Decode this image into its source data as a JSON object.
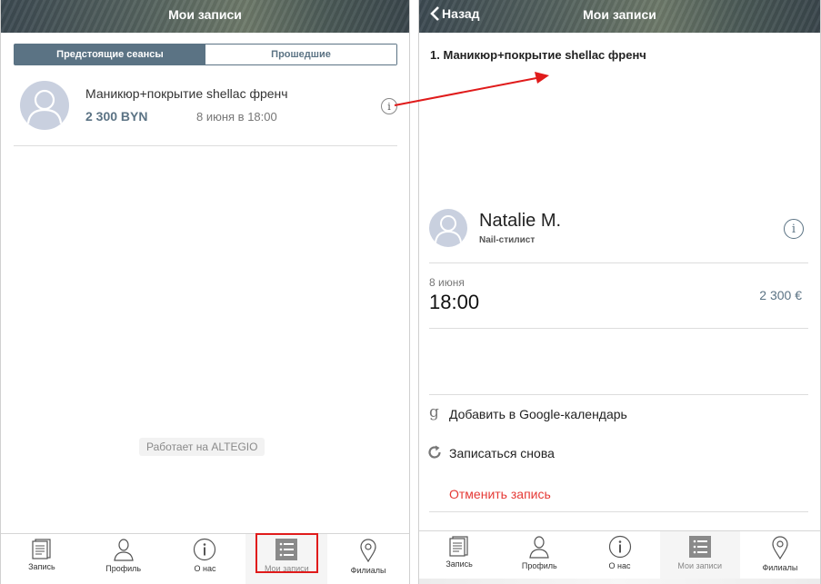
{
  "left_screen": {
    "header": {
      "title": "Мои записи"
    },
    "tabs": [
      {
        "label": "Предстоящие сеансы",
        "active": true
      },
      {
        "label": "Прошедшие",
        "active": false
      }
    ],
    "appointment": {
      "service": "Маникюр+покрытие shellac френч",
      "price": "2 300 BYN",
      "datetime": "8 июня в 18:00",
      "info_icon": "info-icon"
    },
    "powered_by": "Работает на ALTEGIO",
    "tabbar": [
      {
        "label": "Запись",
        "icon": "document-icon",
        "active": false
      },
      {
        "label": "Профиль",
        "icon": "user-icon",
        "active": false
      },
      {
        "label": "О нас",
        "icon": "info-icon",
        "active": false
      },
      {
        "label": "Мои записи",
        "icon": "list-icon",
        "active": true
      },
      {
        "label": "Филиалы",
        "icon": "location-pin-icon",
        "active": false
      }
    ]
  },
  "right_screen": {
    "header": {
      "title": "Мои записи",
      "back_label": "Назад"
    },
    "service_title": "1. Маникюр+покрытие shellac френч",
    "master": {
      "name": "Natalie M.",
      "role": "Nail-стилист"
    },
    "date": "8 июня",
    "time": "18:00",
    "price": "2 300 €",
    "actions": {
      "google": "Добавить в Google-календарь",
      "rebook": "Записаться снова",
      "cancel": "Отменить запись"
    },
    "tabbar": [
      {
        "label": "Запись",
        "icon": "document-icon",
        "active": false
      },
      {
        "label": "Профиль",
        "icon": "user-icon",
        "active": false
      },
      {
        "label": "О нас",
        "icon": "info-icon",
        "active": false
      },
      {
        "label": "Мои записи",
        "icon": "list-icon",
        "active": true
      },
      {
        "label": "Филиалы",
        "icon": "location-pin-icon",
        "active": false
      }
    ]
  },
  "colors": {
    "accent": "#5b7384",
    "cancel": "#e53935",
    "highlight": "#e01b1b",
    "arrow": "#e01b1b"
  }
}
